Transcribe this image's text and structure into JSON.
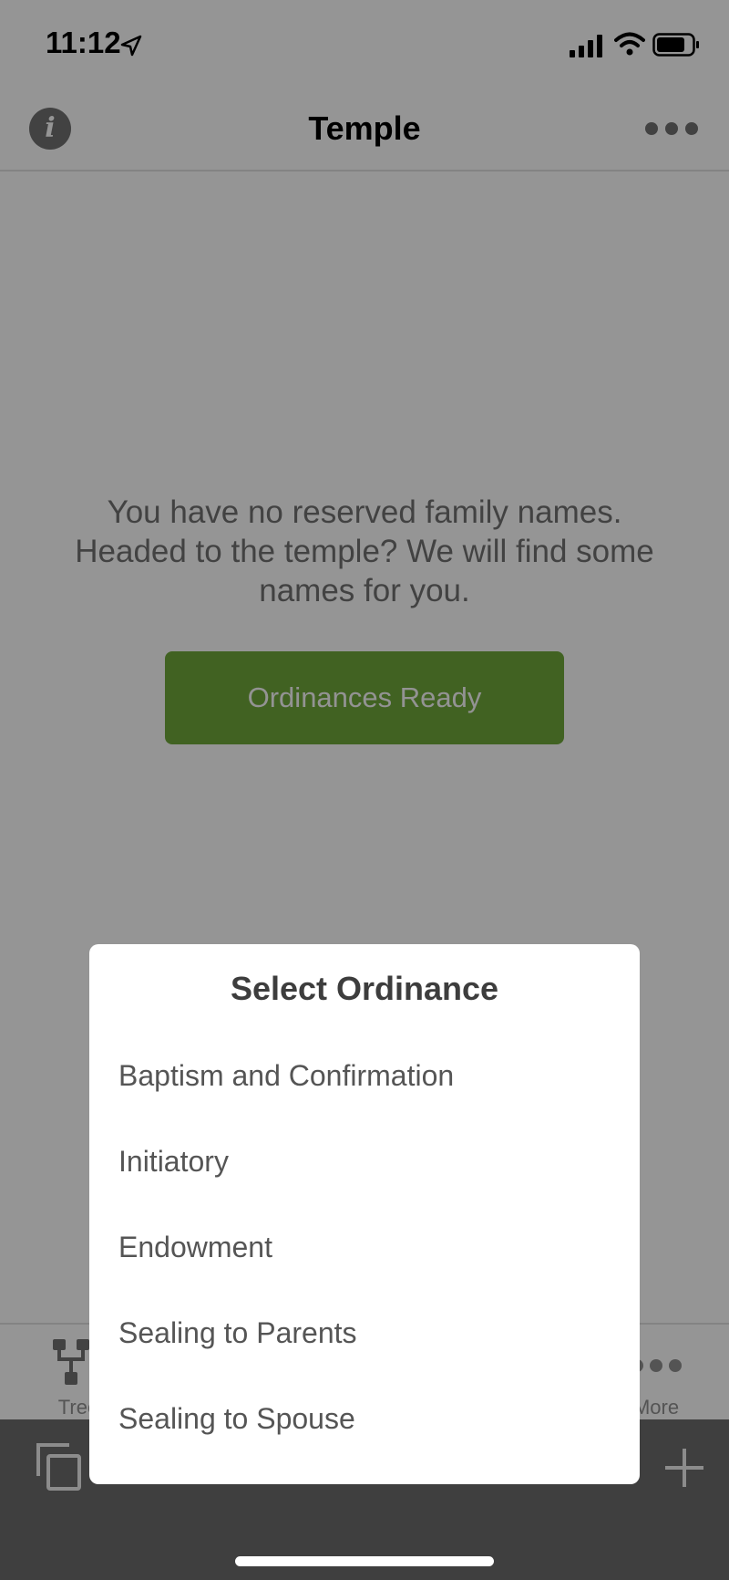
{
  "status_bar": {
    "time": "11:12",
    "icons": [
      "location-arrow-icon",
      "cellular-signal-icon",
      "wifi-icon",
      "battery-icon"
    ]
  },
  "nav": {
    "title": "Temple",
    "left_icon": "info-icon",
    "info_glyph": "i",
    "right_icon": "more-icon"
  },
  "main": {
    "empty_message": "You have no reserved family names. Headed to the temple? We will find some names for you.",
    "button_label": "Ordinances Ready",
    "button_color": "#6aa038"
  },
  "tabbar": {
    "tabs": [
      {
        "label": "Tree",
        "icon": "tree-icon"
      },
      {
        "label": "More",
        "icon": "more-dots-icon"
      }
    ]
  },
  "bottom_toolbar": {
    "left_icon": "copy-icon",
    "right_icon": "plus-icon"
  },
  "dialog": {
    "title": "Select Ordinance",
    "options": [
      "Baptism and Confirmation",
      "Initiatory",
      "Endowment",
      "Sealing to Parents",
      "Sealing to Spouse"
    ]
  },
  "colors": {
    "overlay": "rgba(0,0,0,0.39)",
    "toolbar": "#3f3f3f",
    "dialog_bg": "#ffffff"
  }
}
